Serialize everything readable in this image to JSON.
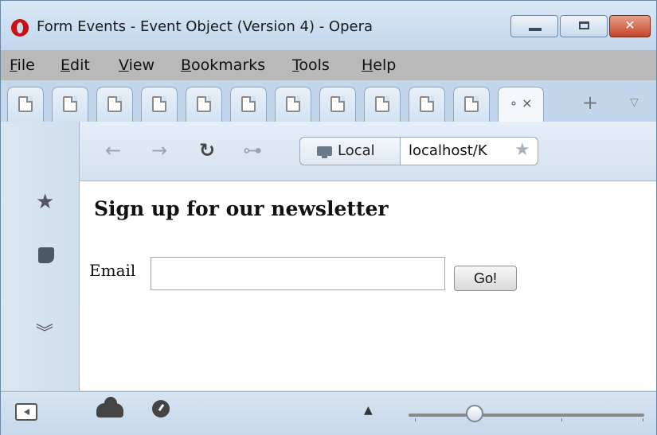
{
  "window": {
    "title": "Form Events - Event Object (Version 4) - Opera",
    "controls": {
      "minimize": "minimize",
      "maximize": "maximize",
      "close": "✕"
    }
  },
  "menu": [
    {
      "key": "F",
      "rest": "ile"
    },
    {
      "key": "E",
      "rest": "dit"
    },
    {
      "key": "V",
      "rest": "iew"
    },
    {
      "key": "B",
      "rest": "ookmarks"
    },
    {
      "key": "T",
      "rest": "ools"
    },
    {
      "key": "H",
      "rest": "elp"
    }
  ],
  "tabs": {
    "count": 11,
    "active_close": "∘ ×",
    "new_tab": "+",
    "menu": "▽"
  },
  "toolbar": {
    "back": "←",
    "forward": "→",
    "reload": "↻",
    "key": "⊶",
    "local_label": "Local",
    "address": "localhost/K",
    "star": "★"
  },
  "side_panel": {
    "icons": [
      "star-icon",
      "notes-icon",
      "expand-icon"
    ]
  },
  "page": {
    "heading": "Sign up for our newsletter",
    "email_label": "Email",
    "email_value": "",
    "go_label": "Go!"
  },
  "status": {
    "zoom_arrow": "▲",
    "zoom_position": 0.28
  }
}
